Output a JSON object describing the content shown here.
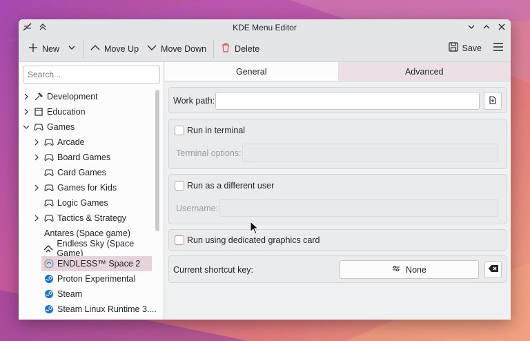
{
  "window": {
    "title": "KDE Menu Editor"
  },
  "toolbar": {
    "new_label": "New",
    "move_up_label": "Move Up",
    "move_down_label": "Move Down",
    "delete_label": "Delete",
    "save_label": "Save"
  },
  "sidebar": {
    "search_placeholder": "Search...",
    "items": [
      {
        "label": "Development",
        "level": 0,
        "expander": "right",
        "icon": "hammer-icon"
      },
      {
        "label": "Education",
        "level": 0,
        "expander": "right",
        "icon": "education-icon"
      },
      {
        "label": "Games",
        "level": 0,
        "expander": "down",
        "icon": "gamepad-icon"
      },
      {
        "label": "Arcade",
        "level": 1,
        "expander": "right",
        "icon": "gamepad-icon"
      },
      {
        "label": "Board Games",
        "level": 1,
        "expander": "right",
        "icon": "gamepad-icon"
      },
      {
        "label": "Card Games",
        "level": 1,
        "expander": "none",
        "icon": "gamepad-icon"
      },
      {
        "label": "Games for Kids",
        "level": 1,
        "expander": "right",
        "icon": "gamepad-icon"
      },
      {
        "label": "Logic Games",
        "level": 1,
        "expander": "none",
        "icon": "gamepad-icon"
      },
      {
        "label": "Tactics & Strategy",
        "level": 1,
        "expander": "right",
        "icon": "gamepad-icon"
      },
      {
        "label": "Antares (Space game)",
        "level": 1,
        "expander": "none",
        "icon": "none"
      },
      {
        "label": "Endless Sky (Space Game)",
        "level": 1,
        "expander": "none",
        "icon": "ship-icon"
      },
      {
        "label": "ENDLESS™ Space 2",
        "level": 1,
        "expander": "none",
        "icon": "endless-icon",
        "selected": true
      },
      {
        "label": "Proton Experimental",
        "level": 1,
        "expander": "none",
        "icon": "steam-icon"
      },
      {
        "label": "Steam",
        "level": 1,
        "expander": "none",
        "icon": "steam-icon"
      },
      {
        "label": "Steam Linux Runtime 3....",
        "level": 1,
        "expander": "none",
        "icon": "steam-icon"
      }
    ]
  },
  "tabs": [
    {
      "label": "General",
      "active": true
    },
    {
      "label": "Advanced",
      "active": false
    }
  ],
  "advanced": {
    "work_path_label": "Work path:",
    "work_path_value": "",
    "run_in_terminal_label": "Run in terminal",
    "terminal_options_label": "Terminal options:",
    "run_as_user_label": "Run as a different user",
    "username_label": "Username:",
    "dedicated_gpu_label": "Run using dedicated graphics card",
    "shortcut_label": "Current shortcut key:",
    "shortcut_value": "None"
  },
  "colors": {
    "accent": "#c9868f",
    "selection": "#e6d3dc",
    "steam_blue": "#1a73c9"
  }
}
